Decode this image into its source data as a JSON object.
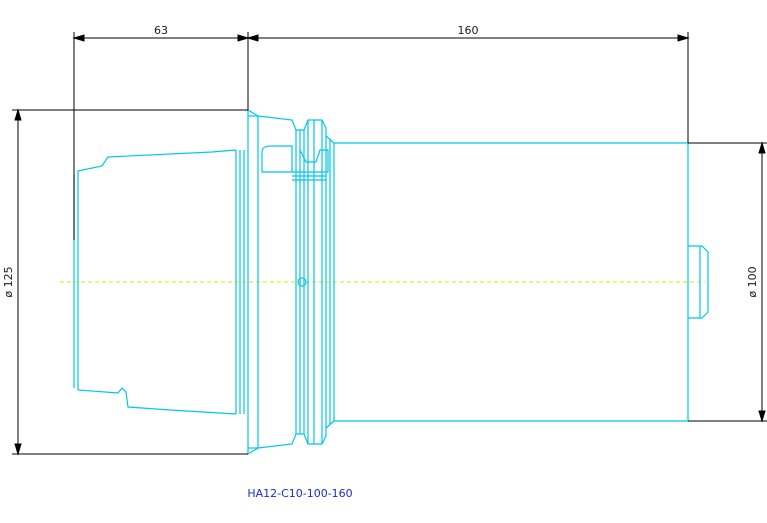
{
  "dimensions": {
    "taper_length": "63",
    "body_length": "160",
    "flange_diameter": "ø 125",
    "body_diameter": "ø 100"
  },
  "part_number": "HA12-C10-100-160",
  "colors": {
    "outline": "#00c8e6",
    "dimension": "#000000",
    "centerline": "#e8e000",
    "label": "#1a2bd6"
  }
}
